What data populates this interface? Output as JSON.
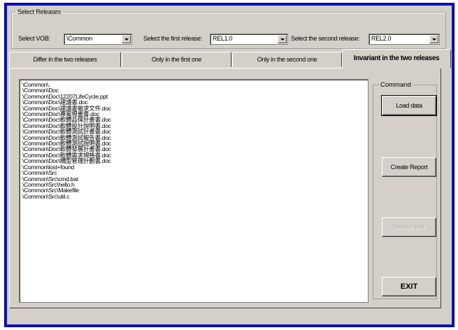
{
  "select_releases": {
    "legend": "Select Releases",
    "vob_label": "Select VOB:",
    "vob_value": "\\Common",
    "first_label": "Select the first release:",
    "first_value": "REL1.0",
    "second_label": "Select the second release:",
    "second_value": "REL2.0"
  },
  "tabs": [
    {
      "label": "Differ in the two releases"
    },
    {
      "label": "Only in the first one"
    },
    {
      "label": "Only in the second one"
    },
    {
      "label": "Invariant in the two releases"
    }
  ],
  "active_tab": 3,
  "file_list": [
    "\\Common\\.",
    "\\Common\\Doc",
    "\\Common\\Doc\\12207LifeCycle.ppt",
    "\\Common\\Doc\\建議書.doc",
    "\\Common\\Doc\\建議書徵求文件.doc",
    "\\Common\\Doc\\專案規畫書.doc",
    "\\Common\\Doc\\軟體品保計畫書.doc",
    "\\Common\\Doc\\軟體設計說明書.doc",
    "\\Common\\Doc\\軟體測試計畫書.doc",
    "\\Common\\Doc\\軟體測試報告書.doc",
    "\\Common\\Doc\\軟體測試說明書.doc",
    "\\Common\\Doc\\軟體發展計畫書.doc",
    "\\Common\\Doc\\軟體需求規格書.doc",
    "\\Common\\Doc\\構型管理計劃書.doc",
    "\\Common\\lost+found",
    "\\Common\\Src",
    "\\Common\\Src\\cmd.bat",
    "\\Common\\Src\\hello.h",
    "\\Common\\Src\\Makefile",
    "\\Common\\Src\\util.c"
  ],
  "command": {
    "legend": "Command",
    "load_label": "Load data",
    "report_label": "Create Report",
    "version_tree_label": "Version tree",
    "exit_label": "EXIT"
  },
  "colors": {
    "window_frame": "#0a12c8",
    "dialog_face": "#d4d0c8"
  }
}
